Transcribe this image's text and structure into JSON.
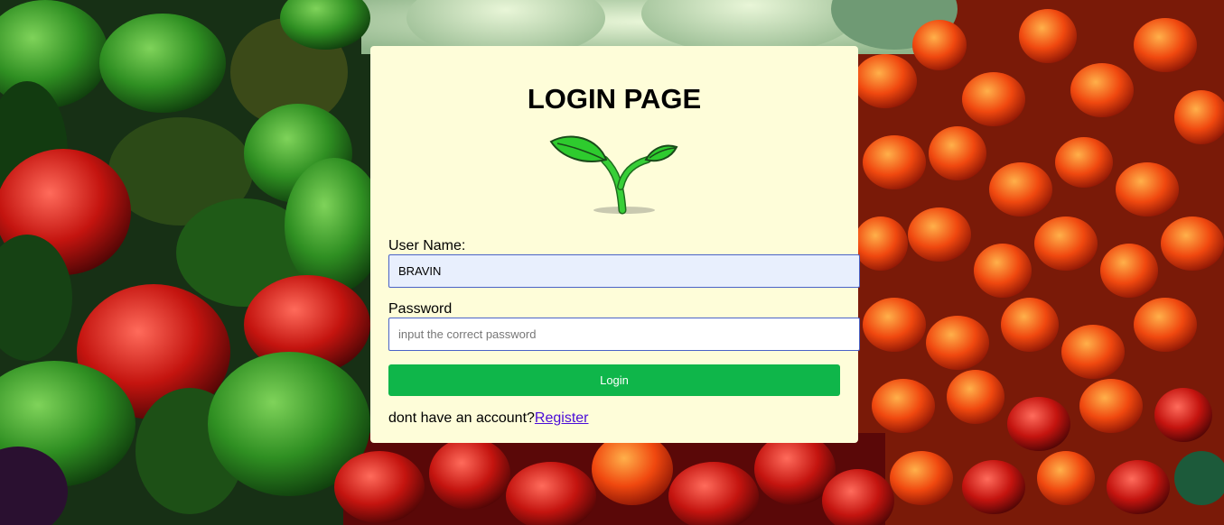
{
  "page": {
    "title": "LOGIN PAGE",
    "background_image": "vegetable-market-peppers-photo",
    "logo_icon": "sprout-icon"
  },
  "form": {
    "username_label": "User Name:",
    "username_value": "BRAVIN",
    "password_label": "Password",
    "password_placeholder": "input the correct password",
    "login_label": "Login",
    "register_prompt": "dont have an account?",
    "register_link": "Register"
  },
  "colors": {
    "card_background": "#fefdd9",
    "login_button": "#0fb64a",
    "input_border": "#4a63c7",
    "autofill_background": "#e8effd",
    "link": "#4a0cd8",
    "sprout_green": "#2ecb2e"
  }
}
